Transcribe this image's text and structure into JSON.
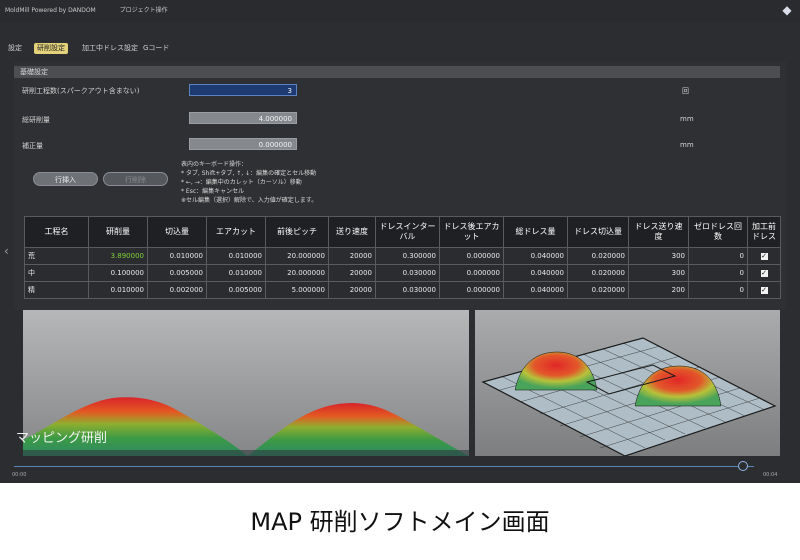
{
  "window": {
    "title_left": "MoldMill Powered by DANDOM",
    "title_mid": "プロジェクト操作"
  },
  "tabs": [
    {
      "label": "設定",
      "active": false
    },
    {
      "label": "研削設定",
      "active": true
    },
    {
      "label": "加工中ドレス設定",
      "active": false
    },
    {
      "label": "Gコード",
      "active": false
    }
  ],
  "basic": {
    "section_title": "基礎設定",
    "rows": [
      {
        "label": "研削工程数(スパークアウト含まない)",
        "value": "3",
        "unit": "回"
      },
      {
        "label": "総研削量",
        "value": "4.000000",
        "unit": "mm"
      },
      {
        "label": "補正量",
        "value": "0.000000",
        "unit": "mm"
      }
    ]
  },
  "buttons": {
    "insert_row": "行挿入",
    "delete_row": "行削除"
  },
  "help_lines": [
    "表内のキーボード操作：",
    "* タブ, Shift+タブ, ↑, ↓：編集の確定とセル移動",
    "* ←, →：編集中のカレット（カーソル）移動",
    "* Esc：編集キャンセル",
    "※セル編集（選択）解除で、入力値が確定します。"
  ],
  "table": {
    "headers": [
      "工程名",
      "研削量",
      "切込量",
      "エアカット",
      "前後ピッチ",
      "送り速度",
      "ドレスインターバル",
      "ドレス後エアカット",
      "総ドレス量",
      "ドレス切込量",
      "ドレス送り速度",
      "ゼロドレス回数",
      "加工前ドレス"
    ],
    "rows": [
      {
        "name": "荒",
        "cells": [
          "3.890000",
          "0.010000",
          "0.010000",
          "20.000000",
          "20000",
          "0.300000",
          "0.000000",
          "0.040000",
          "0.020000",
          "300",
          "0"
        ],
        "checked": true
      },
      {
        "name": "中",
        "cells": [
          "0.100000",
          "0.005000",
          "0.010000",
          "20.000000",
          "20000",
          "0.030000",
          "0.000000",
          "0.040000",
          "0.020000",
          "300",
          "0"
        ],
        "checked": true
      },
      {
        "name": "精",
        "cells": [
          "0.010000",
          "0.002000",
          "0.005000",
          "5.000000",
          "20000",
          "0.030000",
          "0.000000",
          "0.040000",
          "0.020000",
          "200",
          "0"
        ],
        "checked": true
      }
    ]
  },
  "views": {
    "left_overlay_label": "マッピング研削"
  },
  "slider": {
    "min_label": "00:00",
    "max_label": "00:04",
    "value_fraction": 0.985
  },
  "caption": "MAP 研削ソフトメイン画面",
  "colors": {
    "accent_tab": "#e3d27a",
    "active_field": "#1d3a73",
    "highlight_value": "#7fd13a"
  }
}
